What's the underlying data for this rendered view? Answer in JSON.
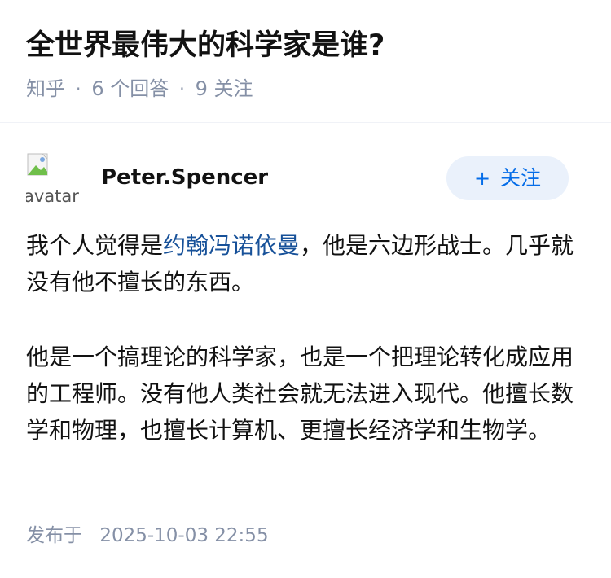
{
  "question": {
    "title": "全世界最伟大的科学家是谁?",
    "meta": {
      "source": "知乎",
      "separator": "·",
      "answers": "6 个回答",
      "followers": "9 关注"
    }
  },
  "answer": {
    "author": {
      "avatar_alt": "avatar",
      "name": "Peter.Spencer",
      "follow_plus": "+",
      "follow_label": "关注"
    },
    "content": {
      "p1_before": "我个人觉得是",
      "p1_link": "约翰冯诺依曼",
      "p1_after": "，他是六边形战士。几乎就没有他不擅长的东西。",
      "p2": "他是一个搞理论的科学家，也是一个把理论转化成应用的工程师。没有他人类社会就无法进入现代。他擅长数学和物理，也擅长计算机、更擅长经济学和生物学。"
    },
    "publish": {
      "label": "发布于",
      "time": "2025-10-03 22:55"
    }
  },
  "colors": {
    "text": "#121212",
    "meta_gray": "#8590a6",
    "link": "#175199",
    "accent_blue": "#056de8",
    "follow_bg": "#eaf1fb",
    "divider": "#f0f2f7"
  }
}
